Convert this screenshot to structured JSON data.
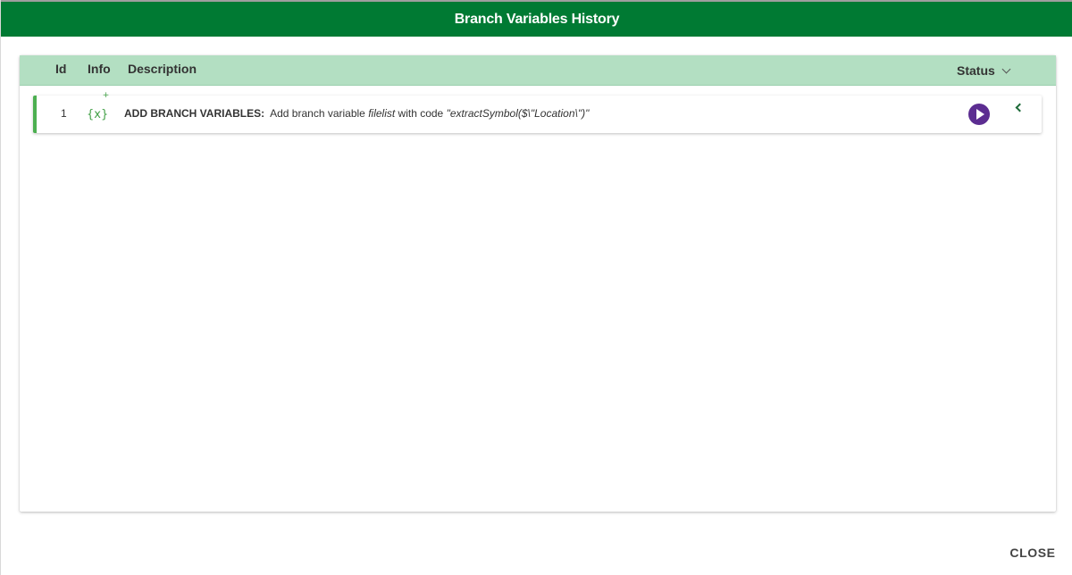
{
  "dialog": {
    "title": "Branch Variables History",
    "close_label": "CLOSE"
  },
  "table": {
    "columns": {
      "id": "Id",
      "info": "Info",
      "description": "Description",
      "status": "Status"
    },
    "rows": [
      {
        "id": "1",
        "info_icon": "variable-add-icon",
        "info_symbol": "{x}",
        "info_plus": "+",
        "action": "ADD BRANCH VARIABLES:",
        "text_1": "Add branch variable ",
        "variable": "filelist",
        "text_2": " with code ",
        "code": "\"extractSymbol($\\\"Location\\\")\"",
        "status_icon": "play-icon",
        "expand_icon": "chevron-left-icon"
      }
    ]
  },
  "colors": {
    "header": "#007a33",
    "table_header": "#b3dfc2",
    "row_accent": "#4caf50",
    "play_button": "#5c2d91"
  }
}
